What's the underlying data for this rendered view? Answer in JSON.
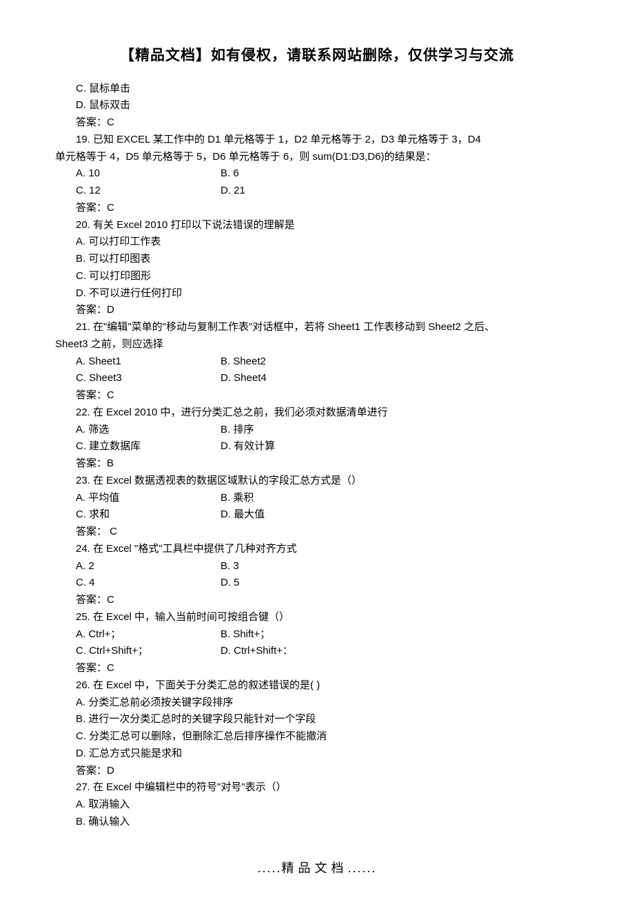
{
  "header": "【精品文档】如有侵权，请联系网站删除，仅供学习与交流",
  "pre_options": {
    "c": "C.  鼠标单击",
    "d": "D.  鼠标双击",
    "ans": "答案：C"
  },
  "q19": {
    "text1": "19.  已知 EXCEL  某工作中的 D1 单元格等于 1，D2 单元格等于 2，D3 单元格等于 3，D4",
    "text2": "单元格等于 4，D5 单元格等于 5，D6 单元格等于 6，则 sum(D1:D3,D6)的结果是：",
    "a": "A. 10",
    "b": "B. 6",
    "c": "C. 12",
    "d": "D. 21",
    "ans": "答案：C"
  },
  "q20": {
    "text": "20.  有关 Excel 2010 打印以下说法错误的理解是",
    "a": "A.  可以打印工作表",
    "b": "B.  可以打印图表",
    "c": "C.  可以打印图形",
    "d": "D.  不可以进行任何打印",
    "ans": "答案：D"
  },
  "q21": {
    "text1": "21.  在\"编辑\"菜单的\"移动与复制工作表\"对话框中，若将 Sheet1 工作表移动到 Sheet2 之后、",
    "text2": "Sheet3 之前，则应选择",
    "a": "A. Sheet1",
    "b": "B. Sheet2",
    "c": "C. Sheet3",
    "d": "D. Sheet4",
    "ans": "答案：C"
  },
  "q22": {
    "text": "22.  在 Excel 2010  中，进行分类汇总之前，我们必须对数据清单进行",
    "a": "A.  筛选",
    "b": "B.  排序",
    "c": "C.  建立数据库",
    "d": "D.  有效计算",
    "ans": "答案：B"
  },
  "q23": {
    "text": "23.  在 Excel  数据透视表的数据区域默认的字段汇总方式是（）",
    "a": "A.  平均值",
    "b": "B.  乘积",
    "c": "C.  求和",
    "d": "D.  最大值",
    "ans": "答案：  C"
  },
  "q24": {
    "text": "24.  在 Excel \"格式\"工具栏中提供了几种对齐方式",
    "a": "A. 2",
    "b": "B. 3",
    "c": "C. 4",
    "d": "D. 5",
    "ans": "答案：C"
  },
  "q25": {
    "text": "25.  在 Excel  中，输入当前时间可按组合键（）",
    "a": "A. Ctrl+；",
    "b": "B. Shift+；",
    "c": "C. Ctrl+Shift+；",
    "d": "D. Ctrl+Shift+：",
    "ans": "答案：C"
  },
  "q26": {
    "text": "26.  在 Excel  中，下面关于分类汇总的叙述错误的是(   )",
    "a": "A.  分类汇总前必须按关键字段排序",
    "b": "B.  进行一次分类汇总时的关键字段只能针对一个字段",
    "c": "C.  分类汇总可以删除，但删除汇总后排序操作不能撤消",
    "d": "D.  汇总方式只能是求和",
    "ans": "答案：D"
  },
  "q27": {
    "text": "27.  在 Excel  中编辑栏中的符号\"对号\"表示（）",
    "a": "A.  取消输入",
    "b": "B.  确认输入"
  },
  "footer": {
    "dots_l": ".....",
    "mid": "精品文档",
    "dots_r": "......"
  }
}
